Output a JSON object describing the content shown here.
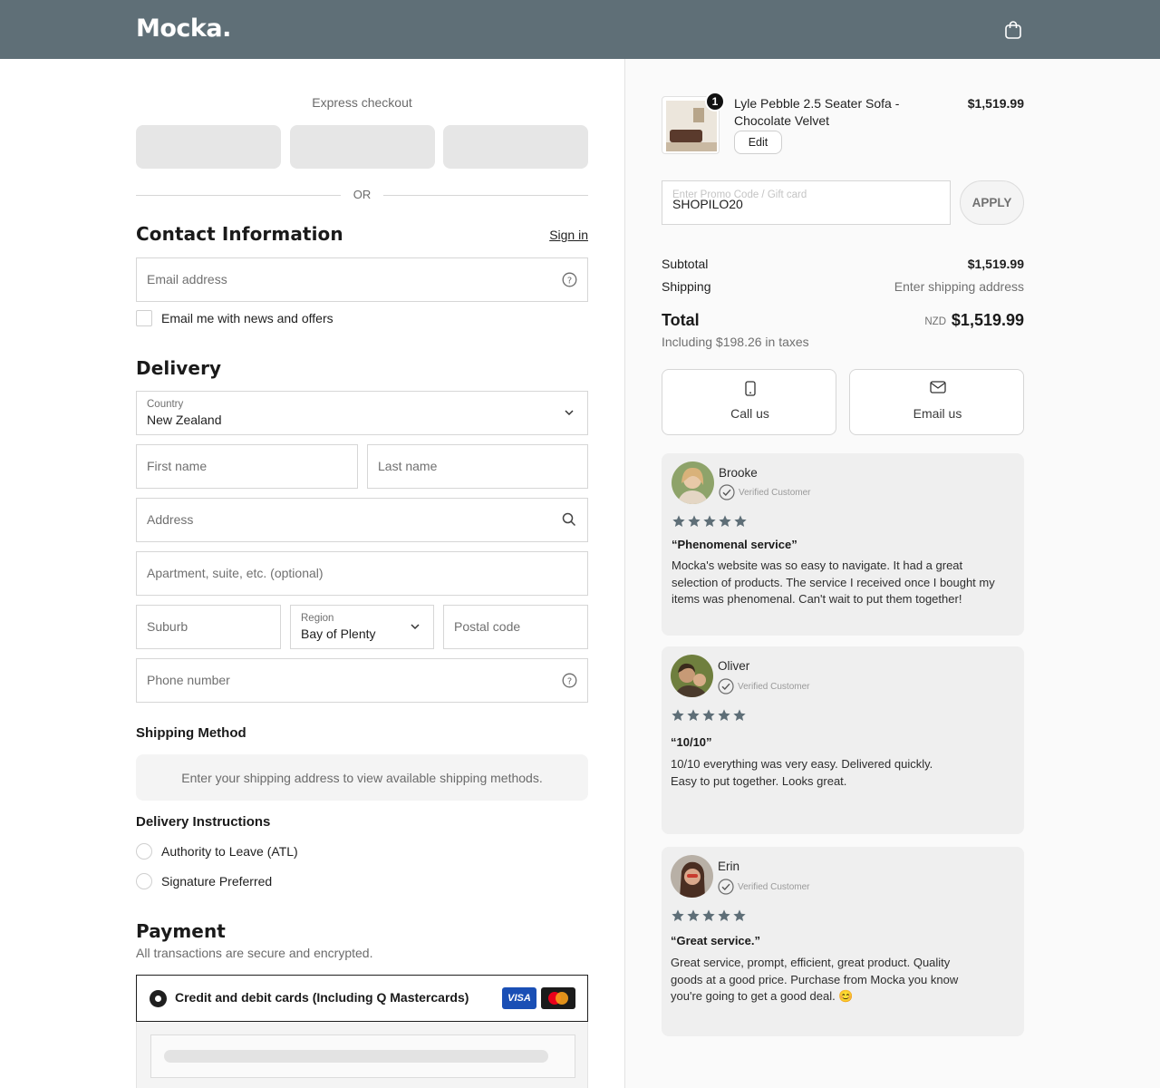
{
  "header": {
    "logo": "Mocka.",
    "cart_icon": "shopping-bag-icon",
    "bg_color": "#5f6f77"
  },
  "express": {
    "label": "Express checkout"
  },
  "divider": {
    "or": "OR"
  },
  "contact": {
    "title": "Contact Information",
    "sign_in": "Sign in",
    "email_placeholder": "Email address",
    "newsletter_label": "Email me with news and offers"
  },
  "delivery": {
    "title": "Delivery",
    "country_label": "Country",
    "country_value": "New Zealand",
    "first_name_placeholder": "First name",
    "last_name_placeholder": "Last name",
    "address_placeholder": "Address",
    "apartment_placeholder": "Apartment, suite, etc. (optional)",
    "suburb_placeholder": "Suburb",
    "region_label": "Region",
    "region_value": "Bay of Plenty",
    "postal_placeholder": "Postal code",
    "phone_placeholder": "Phone number"
  },
  "shipping": {
    "title": "Shipping Method",
    "note": "Enter your shipping address to view available shipping methods."
  },
  "instructions": {
    "title": "Delivery Instructions",
    "options": [
      "Authority to Leave (ATL)",
      "Signature Preferred"
    ]
  },
  "payment": {
    "title": "Payment",
    "subtitle": "All transactions are secure and encrypted.",
    "option_label": "Credit and debit cards (Including Q Mastercards)",
    "visa_label": "VISA"
  },
  "order": {
    "quantity": "1",
    "product_name": "Lyle Pebble 2.5 Seater Sofa - Chocolate Velvet",
    "product_price": "$1,519.99",
    "edit_label": "Edit",
    "discount_placeholder": "Enter Promo Code / Gift card",
    "discount_value": "SHOPILO20",
    "apply_label": "APPLY",
    "subtotal_label": "Subtotal",
    "subtotal_value": "$1,519.99",
    "shipping_label": "Shipping",
    "shipping_value": "Enter shipping address",
    "total_label": "Total",
    "currency": "NZD",
    "total_value": "$1,519.99",
    "tax_note": "Including $198.26 in taxes"
  },
  "support": {
    "call_label": "Call us",
    "email_label": "Email us"
  },
  "reviews": [
    {
      "name": "Brooke",
      "verified": "Verified Customer",
      "rating": 5,
      "title": "“Phenomenal service”",
      "body": "Mocka's website was so easy to navigate. It had a great selection of products. The service I received once I bought my items was phenomenal. Can't wait to put them together!"
    },
    {
      "name": "Oliver",
      "verified": "Verified Customer",
      "rating": 5,
      "title": "“10/10”",
      "body": "10/10 everything was very easy. Delivered quickly. Easy to put together. Looks great."
    },
    {
      "name": "Erin",
      "verified": "Verified Customer",
      "rating": 5,
      "title": "“Great service.”",
      "body": "Great service, prompt, efficient, great product. Quality goods at a good price. Purchase from Mocka you know you're going to get a good deal. 😊"
    }
  ]
}
